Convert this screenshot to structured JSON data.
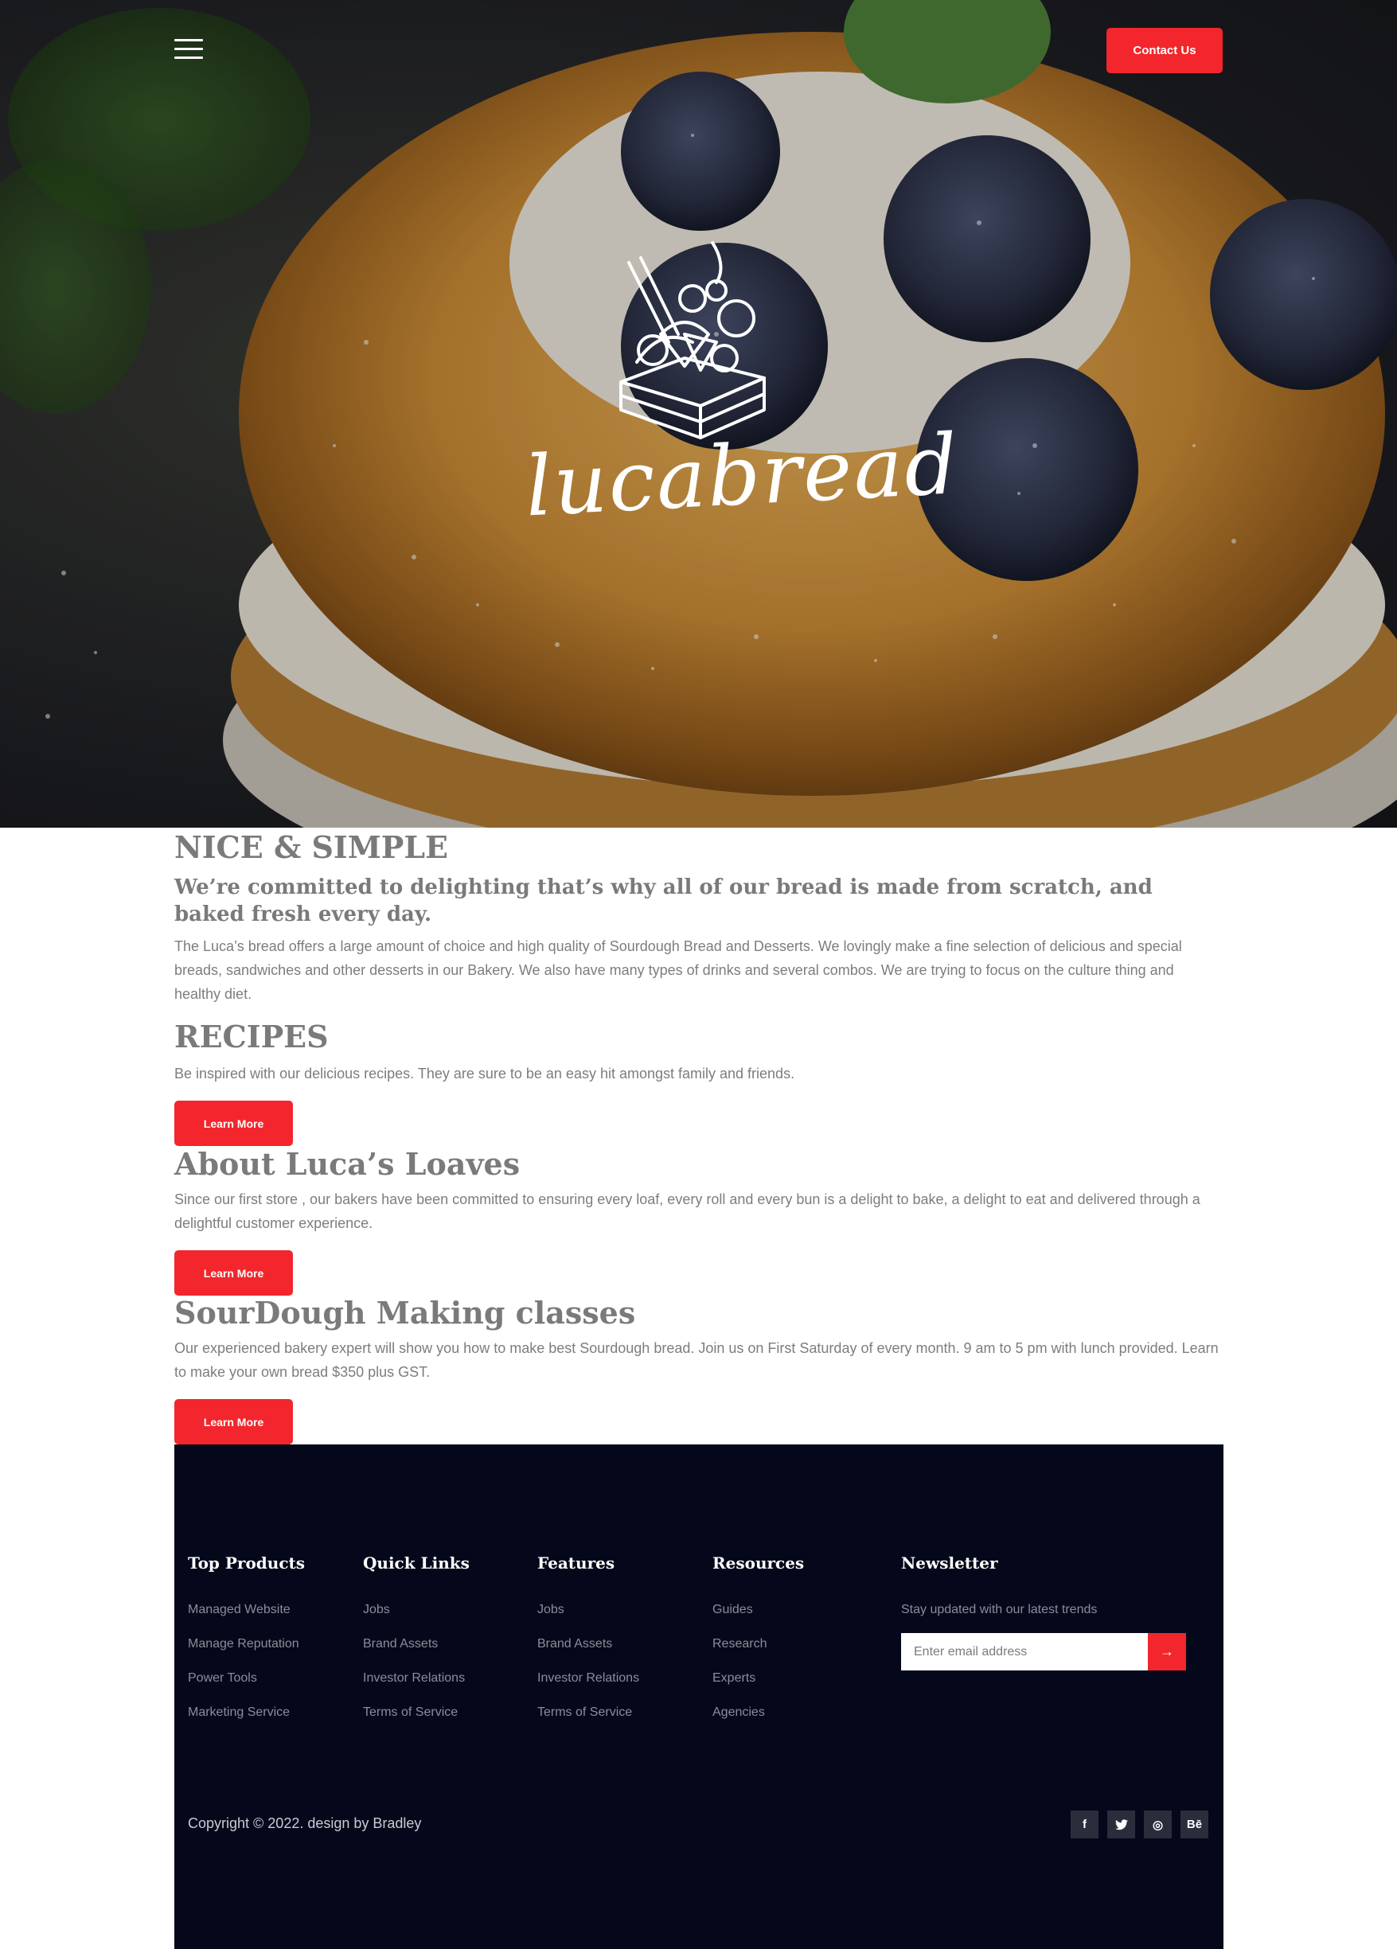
{
  "header": {
    "menu_icon": "hamburger-menu-icon",
    "contact_label": "Contact Us"
  },
  "hero": {
    "logo_icon": "cake-box-icon",
    "brand": "lucabread"
  },
  "sections": {
    "intro": {
      "title": "NICE & SIMPLE",
      "lead": "We’re committed to delighting that’s why all of our bread is made from scratch, and baked fresh every day.",
      "body": "The Luca’s bread offers a large amount of choice and high quality of Sourdough Bread and Desserts. We lovingly make a fine selection of delicious and special breads, sandwiches and other desserts in our Bakery. We also have many types of drinks and several combos. We are trying to focus on the culture thing and healthy diet."
    },
    "recipes": {
      "title": "RECIPES",
      "body": "Be inspired with our delicious recipes. They are sure to be an easy hit amongst family and friends.",
      "button": "Learn More"
    },
    "about": {
      "title": "About Luca’s Loaves",
      "body": "Since our first store , our bakers have been committed to ensuring every loaf, every roll and every bun is a delight to bake, a delight to eat and delivered through a delightful customer experience.",
      "button": "Learn More"
    },
    "classes": {
      "title": "SourDough Making classes",
      "body": "Our experienced bakery expert will show you how to make best Sourdough bread. Join us on First Saturday of every month. 9 am to 5 pm with lunch provided. Learn to make your own bread $350 plus GST.",
      "button": "Learn More"
    }
  },
  "footer": {
    "columns": [
      {
        "title": "Top Products",
        "links": [
          "Managed Website",
          "Manage Reputation",
          "Power Tools",
          "Marketing Service"
        ]
      },
      {
        "title": "Quick Links",
        "links": [
          "Jobs",
          "Brand Assets",
          "Investor Relations",
          "Terms of Service"
        ]
      },
      {
        "title": "Features",
        "links": [
          "Jobs",
          "Brand Assets",
          "Investor Relations",
          "Terms of Service"
        ]
      },
      {
        "title": "Resources",
        "links": [
          "Guides",
          "Research",
          "Experts",
          "Agencies"
        ]
      }
    ],
    "newsletter": {
      "title": "Newsletter",
      "text": "Stay updated with our latest trends",
      "placeholder": "Enter email address",
      "submit_icon": "arrow-right-icon"
    },
    "copyright": "Copyright © 2022. design by Bradley",
    "socials": [
      {
        "icon": "facebook-icon",
        "glyph": "f"
      },
      {
        "icon": "twitter-icon",
        "glyph": "t"
      },
      {
        "icon": "dribbble-icon",
        "glyph": "◎"
      },
      {
        "icon": "behance-icon",
        "glyph": "Bē"
      }
    ]
  },
  "colors": {
    "accent": "#f2262c",
    "footer_bg": "#05081a",
    "text_grey": "#7b7b7b"
  }
}
